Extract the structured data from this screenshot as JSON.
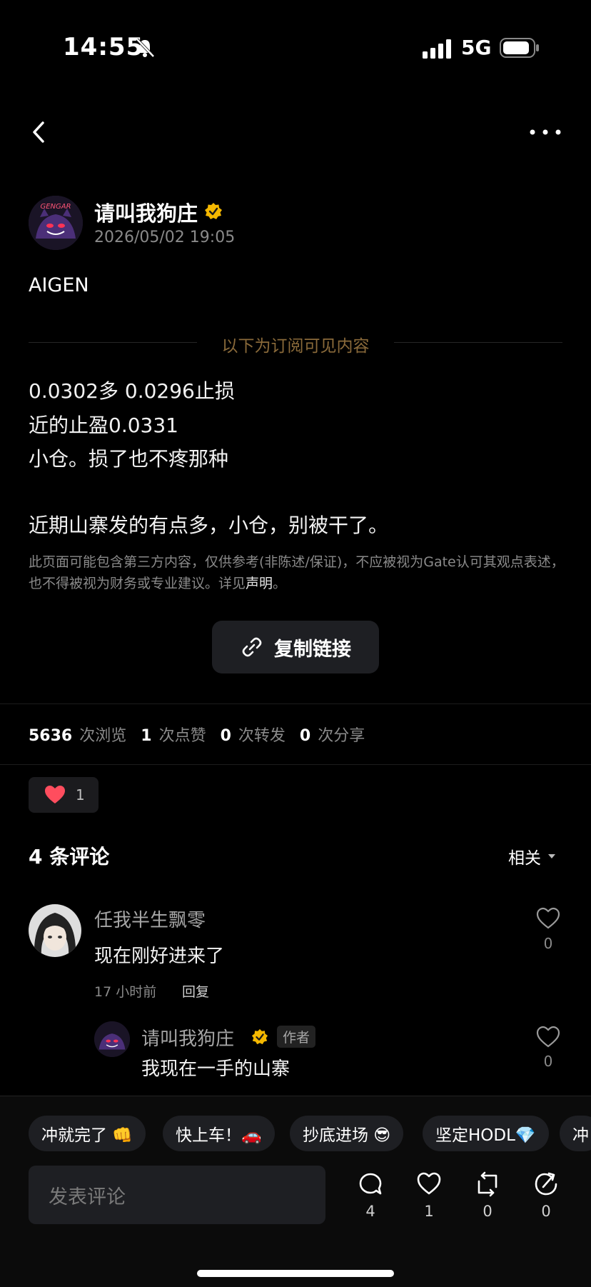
{
  "status_bar": {
    "time": "14:55",
    "network": "5G"
  },
  "post": {
    "author": "请叫我狗庄",
    "timestamp": "2026/05/02 19:05",
    "title": "AIGEN",
    "subscribe_label": "以下为订阅可见内容",
    "lines": [
      "0.0302多 0.0296止损",
      "近的止盈0.0331",
      "小仓。损了也不疼那种",
      "近期山寨发的有点多，小仓，别被干了。"
    ],
    "disclaimer": "此页面可能包含第三方内容，仅供参考(非陈述/保证)，不应被视为Gate认可其观点表述，也不得被视为财务或专业建议。详见",
    "disclaimer_link": "声明",
    "disclaimer_end": "。",
    "copy_link_label": "复制链接"
  },
  "stats": {
    "views": "5636",
    "views_label": "次浏览",
    "likes": "1",
    "likes_label": "次点赞",
    "reposts": "0",
    "reposts_label": "次转发",
    "shares": "0",
    "shares_label": "次分享"
  },
  "reaction": {
    "count": "1"
  },
  "comments": {
    "header": "4 条评论",
    "sort": "相关",
    "items": [
      {
        "name": "任我半生飘零",
        "text": "现在刚好进来了",
        "time": "17 小时前",
        "reply": "回复",
        "likes": "0"
      },
      {
        "name": "请叫我狗庄",
        "tag": "作者",
        "text": "我现在一手的山寨",
        "likes": "0"
      }
    ]
  },
  "quick_replies": [
    "冲就完了 👊",
    "快上车！🚗",
    "抄底进场 😎",
    "坚定HODL💎",
    "冲"
  ],
  "bottom": {
    "input_placeholder": "发表评论",
    "comments_count": "4",
    "likes_count": "1",
    "reposts_count": "0",
    "shares_count": "0"
  },
  "icons": [
    "bell-slash-icon",
    "signal-icon",
    "battery-icon",
    "back-icon",
    "more-icon",
    "verified-icon",
    "link-icon",
    "heart-icon",
    "chevron-down-icon",
    "comment-icon",
    "repost-icon",
    "share-icon"
  ],
  "colors": {
    "background": "#000000",
    "verified": "#f5b800",
    "heart": "#ff4d5e",
    "subscribe_text": "#8a6a3a"
  }
}
